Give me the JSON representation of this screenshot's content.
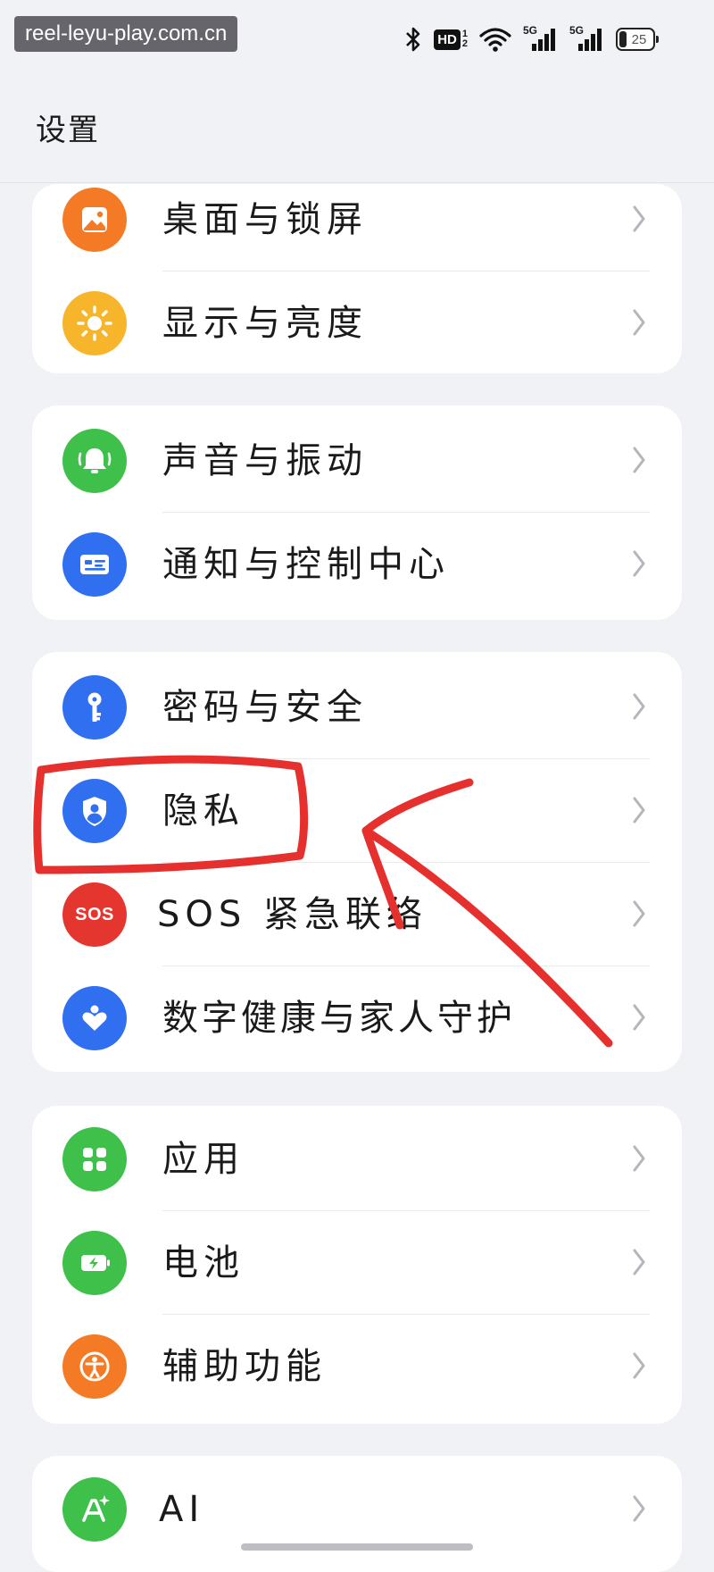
{
  "status_bar": {
    "watermark": "reel-leyu-play.com.cn",
    "hd_badge": "HD",
    "hd_sup": "1",
    "hd_sub": "2",
    "net1": "5G",
    "net2": "5G",
    "battery_level": "25",
    "icons": [
      "bluetooth-icon",
      "wifi-icon",
      "signal-icon",
      "signal-icon",
      "battery-icon"
    ]
  },
  "header": {
    "title": "设置"
  },
  "groups": [
    {
      "items": [
        {
          "label": "桌面与锁屏",
          "icon": "wallpaper-icon",
          "color": "#f57a26"
        },
        {
          "label": "显示与亮度",
          "icon": "sun-icon",
          "color": "#f7b52c"
        }
      ]
    },
    {
      "items": [
        {
          "label": "声音与振动",
          "icon": "bell-icon",
          "color": "#3ec04a"
        },
        {
          "label": "通知与控制中心",
          "icon": "notification-icon",
          "color": "#2f6ff0"
        }
      ]
    },
    {
      "items": [
        {
          "label": "密码与安全",
          "icon": "key-icon",
          "color": "#2f6ff0"
        },
        {
          "label": "隐私",
          "icon": "privacy-shield-icon",
          "color": "#2f6ff0"
        },
        {
          "label": "SOS 紧急联络",
          "icon": "sos-icon",
          "icon_text": "SOS",
          "color": "#e5352f"
        },
        {
          "label": "数字健康与家人守护",
          "icon": "heart-icon",
          "color": "#2f6ff0"
        }
      ]
    },
    {
      "items": [
        {
          "label": "应用",
          "icon": "apps-grid-icon",
          "color": "#3ec04a"
        },
        {
          "label": "电池",
          "icon": "battery-charging-icon",
          "color": "#3ec04a"
        },
        {
          "label": "辅助功能",
          "icon": "accessibility-icon",
          "color": "#f57a26"
        }
      ]
    },
    {
      "items": [
        {
          "label": "AI",
          "icon": "ai-icon",
          "color": "#3ec04a"
        }
      ]
    }
  ],
  "colors": {
    "background": "#f1f2f6",
    "card": "#ffffff",
    "annotation": "#e5302e"
  }
}
